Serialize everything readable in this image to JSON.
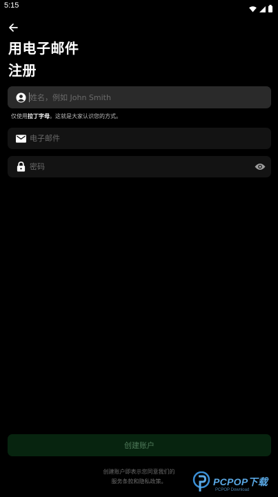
{
  "status_bar": {
    "time": "5:15"
  },
  "header": {
    "title_line1": "用电子邮件",
    "title_line2": "注册"
  },
  "form": {
    "name": {
      "placeholder": "姓名，例如 John Smith",
      "value": "",
      "icon": "account-circle-icon"
    },
    "helper": {
      "prefix": "仅使用",
      "emphasis": "拉丁字母",
      "suffix": "。这就是大家认识您的方式。"
    },
    "email": {
      "placeholder": "电子邮件",
      "value": "",
      "icon": "envelope-icon"
    },
    "password": {
      "placeholder": "密码",
      "value": "",
      "icon": "lock-icon",
      "toggle_icon": "eye-icon"
    }
  },
  "actions": {
    "create_label": "创建账户"
  },
  "footer": {
    "terms_line1": "创建账户即表示您同意我们的",
    "terms_line2": "服务条款和隐私政策。"
  },
  "watermark": {
    "brand": "PCPOP下载",
    "sub": "PCPOP Download"
  },
  "colors": {
    "background": "#000000",
    "field_bg": "#131313",
    "field_active_bg": "#2a2a2a",
    "button_bg": "#07240f",
    "button_text": "#4f7a5a",
    "watermark_blue": "#5aa9e6"
  }
}
